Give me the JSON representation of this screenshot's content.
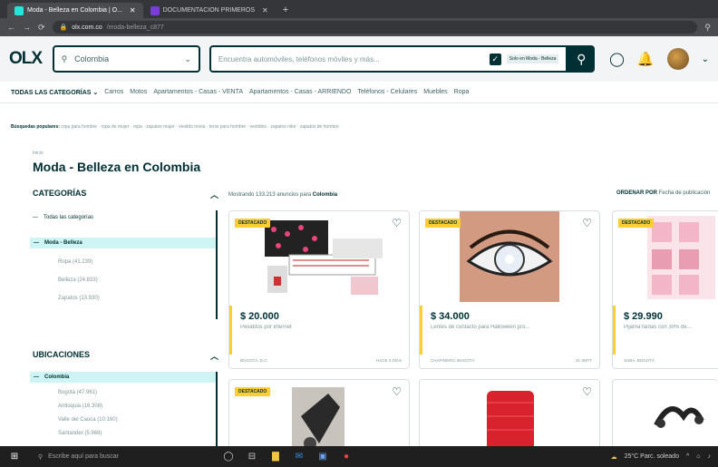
{
  "browser": {
    "tabs": [
      {
        "title": "Moda - Belleza en Colombia | O...",
        "active": true
      },
      {
        "title": "DOCUMENTACION PRIMEROS",
        "active": false
      }
    ],
    "new_tab": "+",
    "url_host": "olx.com.co",
    "url_path": "/moda-belleza_c877"
  },
  "header": {
    "logo": "OLX",
    "location": "Colombia",
    "search_placeholder": "Encuentra automóviles, teléfonos móviles y más...",
    "search_in_category": "Solo en Moda - Belleza"
  },
  "categories_bar": {
    "all_label": "TODAS LAS CATEGORÍAS",
    "links": [
      "Carros",
      "Motos",
      "Apartamentos - Casas - VENTA",
      "Apartamentos - Casas - ARRIENDO",
      "Teléfonos - Celulares",
      "Muebles",
      "Ropa"
    ]
  },
  "popular": {
    "label": "Búsquedas populares:",
    "items": [
      "ropa para hombre",
      "ropa de mujer",
      "ropa",
      "zapatos mujer",
      "vestido novia",
      "tenis para hombre",
      "vestidos",
      "zapatos nike",
      "zapatos de hombre"
    ]
  },
  "breadcrumb": "Inicio",
  "page_title": "Moda - Belleza en Colombia",
  "sidebar": {
    "categories_title": "CATEGORÍAS",
    "all_categories": "Todas las categorías",
    "selected_category": "Moda - Belleza",
    "subcategories": [
      "Ropa (41.239)",
      "Belleza (24.833)",
      "Zapatos (13.930)"
    ],
    "locations_title": "UBICACIONES",
    "selected_location": "Colombia",
    "locations": [
      "Bogotá (47.961)",
      "Antioquia (16.308)",
      "Valle del Cauca (10.160)",
      "Santander (5.968)"
    ]
  },
  "results": {
    "count_text": "Mostrando 133.213 anuncios para",
    "location": "Colombia",
    "order_label": "ORDENAR POR",
    "order_value": "Fecha de publicación"
  },
  "listings": [
    {
      "badge": "DESTACADO",
      "price": "$ 20.000",
      "desc": "Peluditos por internet",
      "place": "BOGOTÁ, D.C.",
      "date": "HACE 3 DÍAS"
    },
    {
      "badge": "DESTACADO",
      "price": "$ 34.000",
      "desc": "Lentes de contacto para Halloween pro...",
      "place": "CHAPINERO, BOGOTÁ",
      "date": "21 SEPT"
    },
    {
      "badge": "DESTACADO",
      "price": "$ 29.990",
      "desc": "Pijama fantas con 30% de...",
      "place": "SUBA, BOGOTÁ",
      "date": ""
    },
    {
      "badge": "DESTACADO"
    },
    {
      "badge": ""
    },
    {
      "badge": ""
    }
  ],
  "taskbar": {
    "search_placeholder": "Escribe aquí para buscar",
    "weather": "25°C Parc. soleado"
  },
  "colors": {
    "brand": "#002f34",
    "accent": "#23e5db",
    "featured": "#ffce32"
  }
}
